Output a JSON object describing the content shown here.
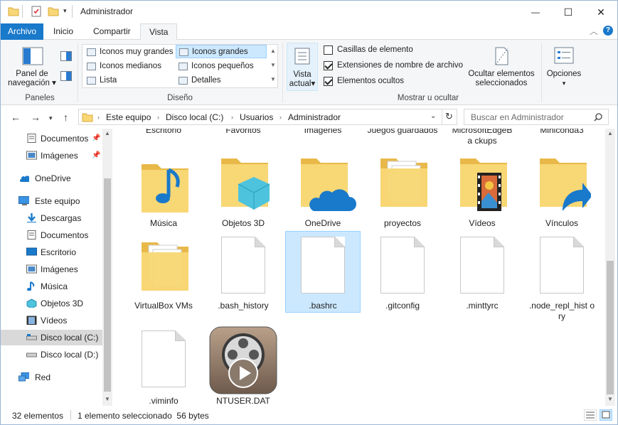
{
  "window": {
    "title": "Administrador",
    "minimize_glyph": "—",
    "maximize_glyph": "☐",
    "close_glyph": "✕"
  },
  "ribbon_tabs": {
    "file": "Archivo",
    "home": "Inicio",
    "share": "Compartir",
    "view": "Vista"
  },
  "ribbon": {
    "panes": {
      "nav_pane_line1": "Panel de",
      "nav_pane_line2": "navegación",
      "group_label": "Paneles"
    },
    "layout": {
      "items": [
        "Iconos muy grandes",
        "Iconos grandes",
        "Iconos medianos",
        "Iconos pequeños",
        "Lista",
        "Detalles"
      ],
      "selected": "Iconos grandes",
      "group_label": "Diseño"
    },
    "current_view": {
      "line1": "Vista",
      "line2": "actual"
    },
    "show_hide": {
      "item_checkboxes": "Casillas de elemento",
      "file_extensions": "Extensiones de nombre de archivo",
      "hidden_items": "Elementos ocultos",
      "item_checkboxes_checked": false,
      "file_extensions_checked": true,
      "hidden_items_checked": true,
      "hide_selected_line1": "Ocultar elementos",
      "hide_selected_line2": "seleccionados",
      "group_label": "Mostrar u ocultar"
    },
    "options": "Opciones"
  },
  "address": {
    "crumbs": [
      "Este equipo",
      "Disco local (C:)",
      "Usuarios",
      "Administrador"
    ],
    "search_placeholder": "Buscar en Administrador"
  },
  "nav_pane": {
    "items": [
      {
        "label": "Documentos",
        "icon": "documents-icon",
        "pinned": true
      },
      {
        "label": "Imágenes",
        "icon": "pictures-icon",
        "pinned": true
      },
      {
        "label": "OneDrive",
        "icon": "onedrive-icon"
      },
      {
        "label": "Este equipo",
        "icon": "this-pc-icon"
      },
      {
        "label": "Descargas",
        "icon": "downloads-icon"
      },
      {
        "label": "Documentos",
        "icon": "documents-icon"
      },
      {
        "label": "Escritorio",
        "icon": "desktop-icon"
      },
      {
        "label": "Imágenes",
        "icon": "pictures-icon"
      },
      {
        "label": "Música",
        "icon": "music-icon"
      },
      {
        "label": "Objetos 3D",
        "icon": "objects-3d-icon"
      },
      {
        "label": "Vídeos",
        "icon": "videos-icon"
      },
      {
        "label": "Disco local (C:)",
        "icon": "drive-icon",
        "selected": true
      },
      {
        "label": "Disco local (D:)",
        "icon": "drive-icon"
      },
      {
        "label": "Red",
        "icon": "network-icon"
      }
    ]
  },
  "files": {
    "partial_top": [
      "Escritorio",
      "Favoritos",
      "Imágenes",
      "Juegos guardados",
      "MicrosoftEdgeBa ckups",
      "Miniconda3"
    ],
    "row1": [
      "Música",
      "Objetos 3D",
      "OneDrive",
      "proyectos",
      "Vídeos",
      "Vínculos"
    ],
    "row2": [
      "VirtualBox VMs",
      ".bash_history",
      ".bashrc",
      ".gitconfig",
      ".minttyrc",
      ".node_repl_hist ory"
    ],
    "row3": [
      ".viminfo",
      "NTUSER.DAT"
    ],
    "selected": ".bashrc"
  },
  "status": {
    "count": "32 elementos",
    "selection": "1 elemento seleccionado  56 bytes"
  },
  "colors": {
    "accent": "#1979ca",
    "folder": "#f8d775",
    "selection": "#cce8ff"
  }
}
